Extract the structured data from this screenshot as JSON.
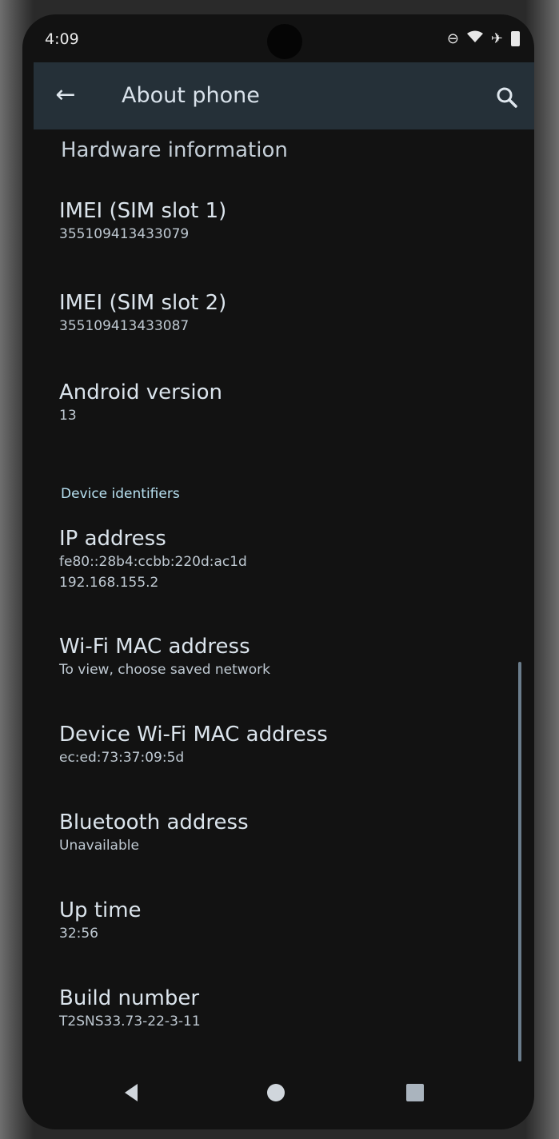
{
  "status_bar": {
    "time": "4:09",
    "icons": [
      "do-not-disturb-icon",
      "wifi-icon",
      "airplane-icon",
      "battery-icon"
    ]
  },
  "app_bar": {
    "title": "About phone"
  },
  "section": {
    "title": "Hardware information"
  },
  "items": [
    {
      "title": "IMEI (SIM slot 1)",
      "value": "355109413433079"
    },
    {
      "title": "IMEI (SIM slot 2)",
      "value": "355109413433087"
    },
    {
      "title": "Android version",
      "value": "13"
    }
  ],
  "subheader": "Device identifiers",
  "ip": {
    "title": "IP address",
    "value1": "fe80::28b4:ccbb:220d:ac1d",
    "value2": "192.168.155.2"
  },
  "items2": [
    {
      "title": "Wi-Fi MAC address",
      "value": "To view, choose saved network"
    },
    {
      "title": "Device Wi-Fi MAC address",
      "value": "ec:ed:73:37:09:5d"
    },
    {
      "title": "Bluetooth address",
      "value": "Unavailable"
    },
    {
      "title": "Up time",
      "value": "32:56"
    },
    {
      "title": "Build number",
      "value": "T2SNS33.73-22-3-11"
    }
  ],
  "colors": {
    "screen_bg": "#121212",
    "app_bar_bg": "#253038",
    "subheader": "#b7e0f0"
  }
}
